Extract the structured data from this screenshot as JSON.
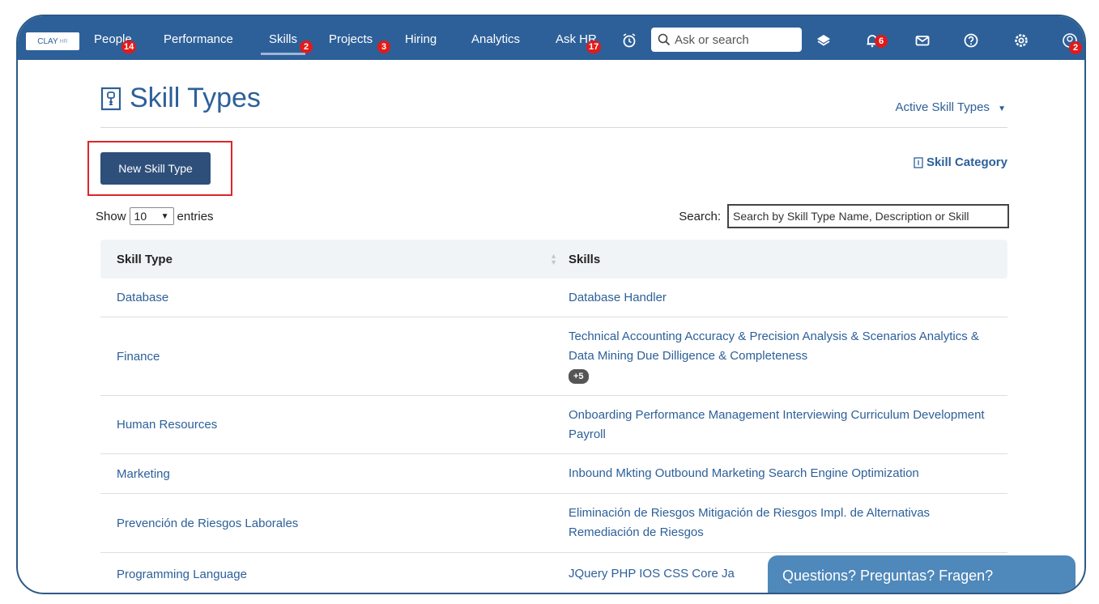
{
  "brand": {
    "logo_main": "CLAY",
    "logo_sub": "HR"
  },
  "nav": {
    "items": [
      {
        "label": "People",
        "badge": "14"
      },
      {
        "label": "Performance",
        "badge": ""
      },
      {
        "label": "Skills",
        "badge": "2"
      },
      {
        "label": "Projects",
        "badge": "3"
      },
      {
        "label": "Hiring",
        "badge": ""
      },
      {
        "label": "Analytics",
        "badge": ""
      },
      {
        "label": "Ask HR",
        "badge": "17"
      }
    ],
    "search_placeholder": "Ask or search",
    "notifications_badge": "6",
    "avatar_badge": "2"
  },
  "page": {
    "title": "Skill Types",
    "filter_label": "Active Skill Types",
    "new_button": "New Skill Type",
    "category_link": "Skill Category",
    "show_label": "Show",
    "entries_value": "10",
    "entries_label": "entries",
    "search_label": "Search:",
    "search_placeholder": "Search by Skill Type Name, Description or Skill"
  },
  "table": {
    "headers": [
      "Skill Type",
      "Skills"
    ],
    "rows": [
      {
        "type": "Database",
        "skills": "Database Handler",
        "more": ""
      },
      {
        "type": "Finance",
        "skills": "Technical Accounting  Accuracy & Precision  Analysis & Scenarios  Analytics & Data Mining  Due Dilligence & Completeness",
        "more": "+5"
      },
      {
        "type": "Human Resources",
        "skills": "Onboarding  Performance Management  Interviewing  Curriculum Development  Payroll",
        "more": ""
      },
      {
        "type": "Marketing",
        "skills": "Inbound Mkting  Outbound Marketing  Search Engine Optimization",
        "more": ""
      },
      {
        "type": "Prevención de Riesgos Laborales",
        "skills": "Eliminación de Riesgos  Mitigación de Riesgos  Impl. de Alternativas  Remediación de Riesgos",
        "more": ""
      },
      {
        "type": "Programming Language",
        "skills": "JQuery  PHP  IOS  CSS  Core Ja",
        "more": ""
      }
    ]
  },
  "help": {
    "label": "Questions? Preguntas? Fragen?"
  },
  "colors": {
    "nav_bg": "#2d6099",
    "accent": "#2d6099",
    "button": "#2d4f7a",
    "highlight": "#e0242a",
    "badge": "#e11a1a"
  }
}
